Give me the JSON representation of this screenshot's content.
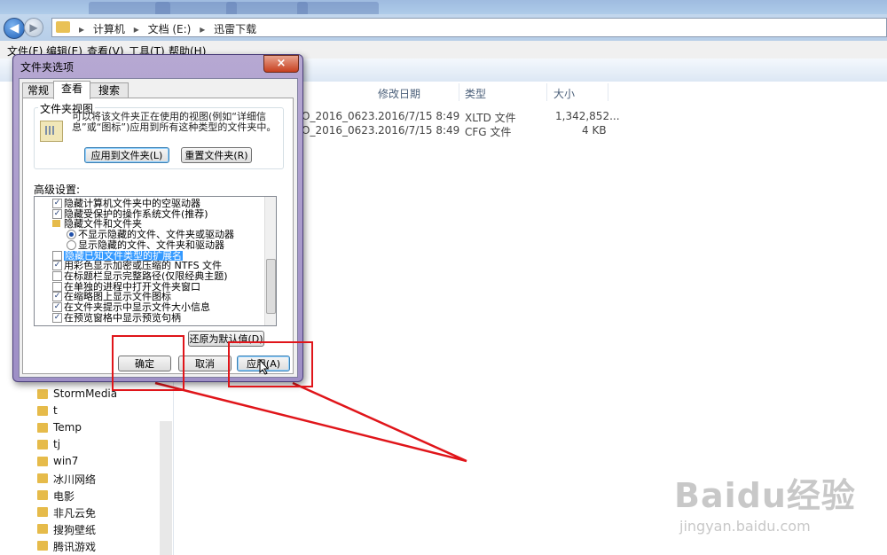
{
  "explorer": {
    "breadcrumb": [
      "计算机",
      "文档 (E:)",
      "迅雷下载"
    ],
    "menu": [
      "文件(F)",
      "编辑(E)",
      "查看(V)",
      "工具(T)",
      "帮助(H)"
    ],
    "columns": {
      "date": "修改日期",
      "type": "类型",
      "size": "大小"
    },
    "files": [
      {
        "name": "O_2016_0623...",
        "date": "2016/7/15 8:49",
        "type": "XLTD 文件",
        "size": "1,342,852..."
      },
      {
        "name": "O_2016_0623...",
        "date": "2016/7/15 8:49",
        "type": "CFG 文件",
        "size": "4 KB"
      }
    ],
    "nav_folders": [
      "StormMedia",
      "t",
      "Temp",
      "tj",
      "win7",
      "冰川网络",
      "电影",
      "非凡云免",
      "搜狗壁纸",
      "腾讯游戏"
    ]
  },
  "dialog": {
    "title": "文件夹选项",
    "close": "×",
    "tabs": [
      "常规",
      "查看",
      "搜索"
    ],
    "folder_view": {
      "legend": "文件夹视图",
      "description": "可以将该文件夹正在使用的视图(例如“详细信息”或“图标”)应用到所有这种类型的文件夹中。",
      "apply_button": "应用到文件夹(L)",
      "reset_button": "重置文件夹(R)"
    },
    "advanced_label": "高级设置:",
    "advanced_items": [
      {
        "kind": "check",
        "checked": true,
        "indent": 0,
        "label": "隐藏计算机文件夹中的空驱动器"
      },
      {
        "kind": "check",
        "checked": true,
        "indent": 0,
        "label": "隐藏受保护的操作系统文件(推荐)"
      },
      {
        "kind": "folder",
        "indent": 0,
        "label": "隐藏文件和文件夹"
      },
      {
        "kind": "radio",
        "checked": true,
        "indent": 1,
        "label": "不显示隐藏的文件、文件夹或驱动器"
      },
      {
        "kind": "radio",
        "checked": false,
        "indent": 1,
        "label": "显示隐藏的文件、文件夹和驱动器"
      },
      {
        "kind": "check",
        "checked": false,
        "indent": 0,
        "label": "隐藏已知文件类型的扩展名",
        "selected": true
      },
      {
        "kind": "check",
        "checked": true,
        "indent": 0,
        "label": "用彩色显示加密或压缩的 NTFS 文件"
      },
      {
        "kind": "check",
        "checked": false,
        "indent": 0,
        "label": "在标题栏显示完整路径(仅限经典主题)"
      },
      {
        "kind": "check",
        "checked": false,
        "indent": 0,
        "label": "在单独的进程中打开文件夹窗口"
      },
      {
        "kind": "check",
        "checked": true,
        "indent": 0,
        "label": "在缩略图上显示文件图标"
      },
      {
        "kind": "check",
        "checked": true,
        "indent": 0,
        "label": "在文件夹提示中显示文件大小信息"
      },
      {
        "kind": "check",
        "checked": true,
        "indent": 0,
        "label": "在预览窗格中显示预览句柄"
      }
    ],
    "restore_defaults": "还原为默认值(D)",
    "ok": "确定",
    "cancel": "取消",
    "apply": "应用(A)"
  },
  "watermark": {
    "brand": "Baidu经验",
    "url": "jingyan.baidu.com"
  },
  "colors": {
    "annotation_red": "#e0151a",
    "selection_blue": "#3399ff",
    "dialog_frame": "#a999cc"
  }
}
